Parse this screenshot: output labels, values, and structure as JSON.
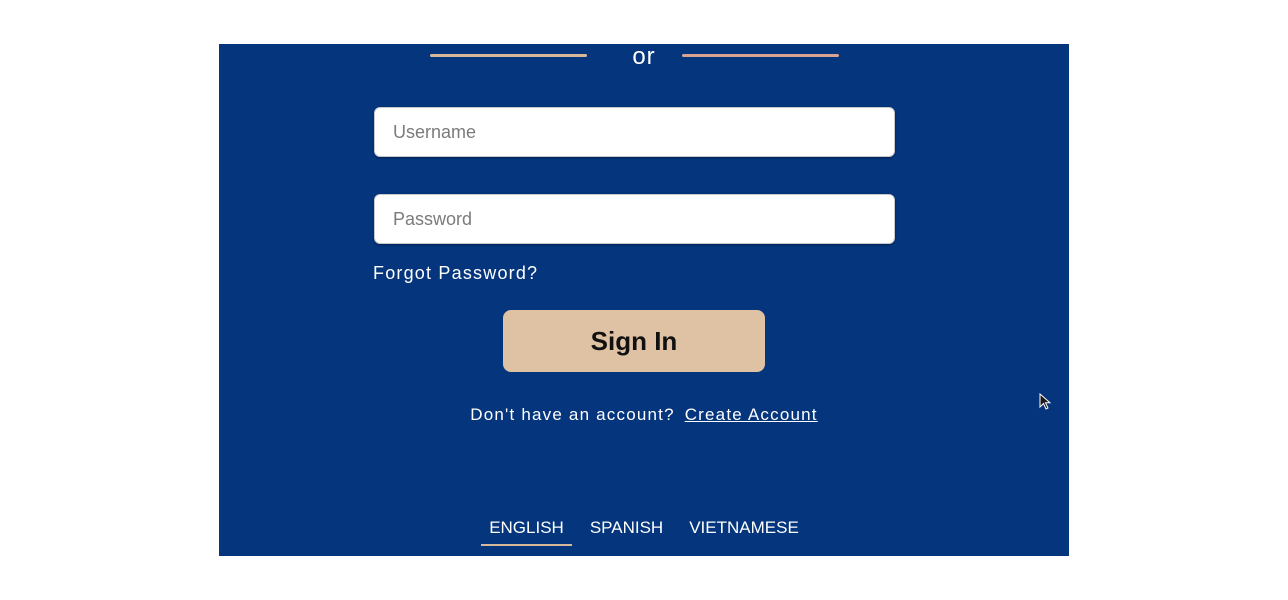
{
  "divider": {
    "text": "or"
  },
  "form": {
    "username_placeholder": "Username",
    "password_placeholder": "Password",
    "forgot_label": "Forgot Password?",
    "signin_label": "Sign In"
  },
  "account": {
    "prompt": "Don't have an account?",
    "create_label": "Create Account"
  },
  "languages": {
    "items": [
      "ENGLISH",
      "SPANISH",
      "VIETNAMESE"
    ],
    "active": "ENGLISH"
  },
  "colors": {
    "panel_bg": "#04357d",
    "button_bg": "#dfc1a4",
    "accent": "#d8b89a"
  }
}
